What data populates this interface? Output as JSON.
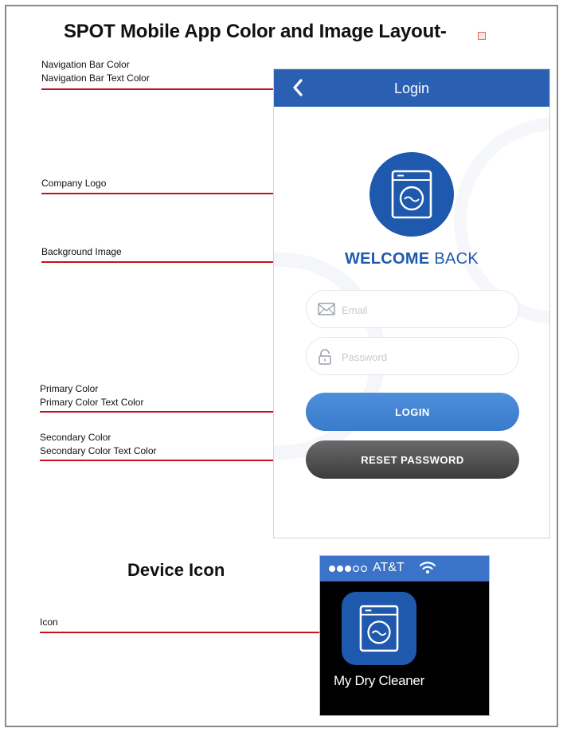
{
  "document": {
    "title": "SPOT Mobile App Color and Image Layout-"
  },
  "annotations": {
    "navigation": {
      "line1": "Navigation Bar Color",
      "line2": "Navigation Bar Text Color"
    },
    "logo": {
      "line1": "Company Logo"
    },
    "background": {
      "line1": "Background Image"
    },
    "primary": {
      "line1": "Primary Color",
      "line2": "Primary  Color Text Color"
    },
    "secondary": {
      "line1": "Secondary Color",
      "line2": "Secondary Color Text Color"
    },
    "icon": {
      "line1": "Icon"
    }
  },
  "app": {
    "navbar": {
      "title": "Login",
      "back_icon": "chevron-left-icon",
      "color": "#2a5fb1",
      "text_color": "#ffffff"
    },
    "logo_icon": "washing-machine-icon",
    "welcome": {
      "bold": "WELCOME",
      "regular": "BACK",
      "color": "#1f59ad"
    },
    "email": {
      "placeholder": "Email",
      "icon": "envelope-icon"
    },
    "password": {
      "placeholder": "Password",
      "icon": "lock-icon"
    },
    "login_button": {
      "label": "LOGIN",
      "color": "#3f82d1"
    },
    "reset_button": {
      "label": "RESET PASSWORD",
      "color": "#4d4d4d"
    }
  },
  "device_section": {
    "title": "Device Icon",
    "status_bar": {
      "carrier": "AT&T",
      "signal_icon": "signal-dots-icon",
      "wifi_icon": "wifi-icon",
      "color": "#3a73c8"
    },
    "app_icon": "washing-machine-icon",
    "app_name": "My Dry Cleaner"
  },
  "colors": {
    "leader_line": "#c5101f"
  }
}
